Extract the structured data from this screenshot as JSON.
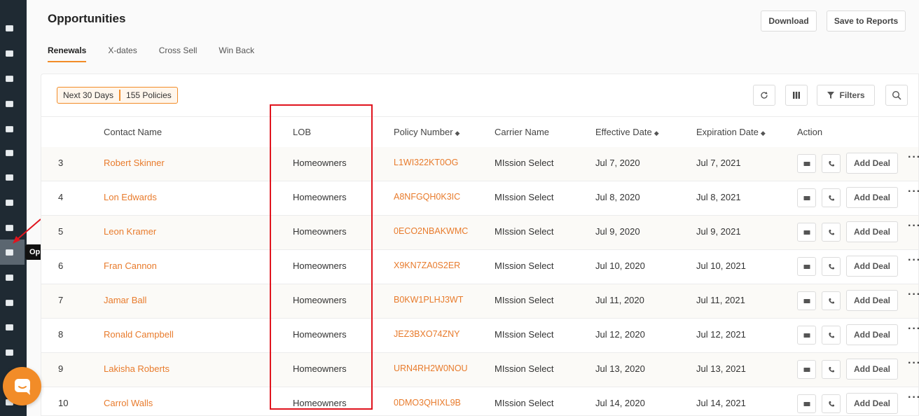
{
  "sidebar": {
    "tooltip": "Opportunities",
    "icons": [
      "dashboard-icon",
      "contacts-icon",
      "policies-icon",
      "carriers-icon",
      "list-icon",
      "id-card-icon",
      "funnel-icon",
      "megaphone-icon",
      "document-icon",
      "opportunities-icon",
      "chart-icon",
      "table-icon",
      "calendar-icon",
      "printer-icon",
      "user-icon"
    ]
  },
  "header": {
    "title": "Opportunities",
    "download_label": "Download",
    "save_label": "Save to Reports"
  },
  "tabs": [
    {
      "label": "Renewals",
      "active": true
    },
    {
      "label": "X-dates",
      "active": false
    },
    {
      "label": "Cross Sell",
      "active": false
    },
    {
      "label": "Win Back",
      "active": false
    }
  ],
  "filter_chip": {
    "range": "Next 30 Days",
    "count": "155 Policies"
  },
  "toolbar": {
    "filters_label": "Filters"
  },
  "table": {
    "columns": {
      "contact": "Contact Name",
      "lob": "LOB",
      "policy": "Policy Number",
      "carrier": "Carrier Name",
      "effective": "Effective Date",
      "expiration": "Expiration Date",
      "action": "Action"
    },
    "add_deal_label": "Add Deal",
    "more_label": "···",
    "rows": [
      {
        "num": "3",
        "contact": "Robert Skinner",
        "lob": "Homeowners",
        "policy": "L1WI322KT0OG",
        "carrier": "MIssion Select",
        "effective": "Jul 7, 2020",
        "expiration": "Jul 7, 2021"
      },
      {
        "num": "4",
        "contact": "Lon Edwards",
        "lob": "Homeowners",
        "policy": "A8NFGQH0K3IC",
        "carrier": "MIssion Select",
        "effective": "Jul 8, 2020",
        "expiration": "Jul 8, 2021"
      },
      {
        "num": "5",
        "contact": "Leon Kramer",
        "lob": "Homeowners",
        "policy": "0ECO2NBAKWMC",
        "carrier": "MIssion Select",
        "effective": "Jul 9, 2020",
        "expiration": "Jul 9, 2021"
      },
      {
        "num": "6",
        "contact": "Fran Cannon",
        "lob": "Homeowners",
        "policy": "X9KN7ZA0S2ER",
        "carrier": "MIssion Select",
        "effective": "Jul 10, 2020",
        "expiration": "Jul 10, 2021"
      },
      {
        "num": "7",
        "contact": "Jamar Ball",
        "lob": "Homeowners",
        "policy": "B0KW1PLHJ3WT",
        "carrier": "MIssion Select",
        "effective": "Jul 11, 2020",
        "expiration": "Jul 11, 2021"
      },
      {
        "num": "8",
        "contact": "Ronald Campbell",
        "lob": "Homeowners",
        "policy": "JEZ3BXO74ZNY",
        "carrier": "MIssion Select",
        "effective": "Jul 12, 2020",
        "expiration": "Jul 12, 2021"
      },
      {
        "num": "9",
        "contact": "Lakisha Roberts",
        "lob": "Homeowners",
        "policy": "URN4RH2W0NOU",
        "carrier": "MIssion Select",
        "effective": "Jul 13, 2020",
        "expiration": "Jul 13, 2021"
      },
      {
        "num": "10",
        "contact": "Carrol Walls",
        "lob": "Homeowners",
        "policy": "0DMO3QHIXL9B",
        "carrier": "MIssion Select",
        "effective": "Jul 14, 2020",
        "expiration": "Jul 14, 2021"
      }
    ]
  },
  "colors": {
    "accent": "#f28c28",
    "highlight": "#e0141e",
    "sidebar": "#1f2a33"
  }
}
